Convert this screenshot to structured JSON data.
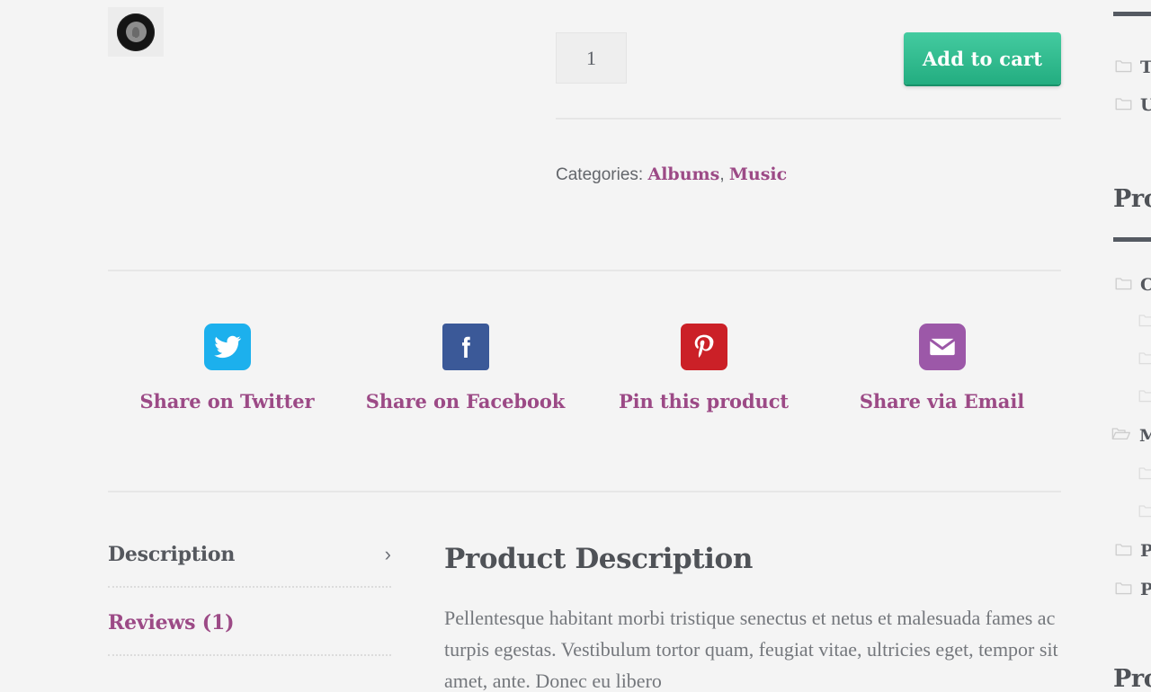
{
  "product": {
    "thumbnail_alt": "vinyl-record-thumbnail",
    "quantity_value": "1",
    "quantity_placeholder": "1",
    "add_to_cart_label": "Add to cart",
    "categories_label": "Categories:",
    "categories": [
      "Albums",
      "Music"
    ],
    "category_separator": ", "
  },
  "share": {
    "items": [
      {
        "icon": "twitter-icon",
        "label": "Share on Twitter",
        "color": "#1cb0ed"
      },
      {
        "icon": "facebook-icon",
        "label": "Share on Facebook",
        "color": "#3b5998"
      },
      {
        "icon": "pinterest-icon",
        "label": "Pin this product",
        "color": "#cb2027"
      },
      {
        "icon": "email-icon",
        "label": "Share via Email",
        "color": "#9c58a8"
      }
    ]
  },
  "tabs": [
    {
      "label": "Description",
      "chevron": "›",
      "active": true
    },
    {
      "label": "Reviews (1)",
      "chevron": "",
      "active": false
    }
  ],
  "description": {
    "title": "Product Description",
    "body": "Pellentesque habitant morbi tristique senectus et netus et malesuada fames ac turpis egestas. Vestibulum tortor quam, feugiat vitae, ultricies eget, tempor sit amet, ante. Donec eu libero"
  },
  "sidebar": {
    "sections": [
      {
        "heading": "",
        "items": [
          {
            "label": "T",
            "icon": "folder-icon",
            "level": 0
          },
          {
            "label": "U",
            "icon": "folder-icon",
            "level": 0
          }
        ]
      },
      {
        "heading": "Pro",
        "items": [
          {
            "label": "C",
            "icon": "folder-icon",
            "level": 0
          },
          {
            "label": "",
            "icon": "folder-icon",
            "level": 1
          },
          {
            "label": "",
            "icon": "folder-icon",
            "level": 1
          },
          {
            "label": "",
            "icon": "folder-icon",
            "level": 1
          },
          {
            "label": "",
            "icon": "folder-icon",
            "level": 1
          },
          {
            "label": "M",
            "icon": "folder-open-icon",
            "level": 0
          },
          {
            "label": "",
            "icon": "folder-icon",
            "level": 1
          },
          {
            "label": "",
            "icon": "folder-icon",
            "level": 1
          },
          {
            "label": "P",
            "icon": "folder-icon",
            "level": 0
          },
          {
            "label": "P",
            "icon": "folder-icon",
            "level": 0
          }
        ]
      },
      {
        "heading": "Pro",
        "items": []
      }
    ]
  },
  "colors": {
    "page_background": "#f4f4f4",
    "link_purple": "#9c4a86",
    "heading_gray": "#4f5257",
    "body_gray": "#74777c",
    "cart_green_top": "#44cba0",
    "cart_green_bottom": "#23ad80"
  }
}
